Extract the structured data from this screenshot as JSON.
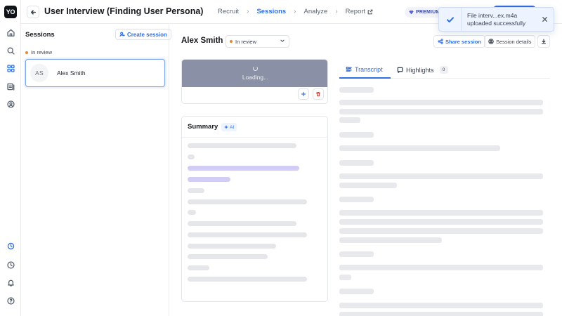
{
  "app": {
    "logo_text": "YO",
    "project_title": "User Interview (Finding User Persona)"
  },
  "nav_steps": [
    {
      "label": "Recruit",
      "active": false
    },
    {
      "label": "Sessions",
      "active": true
    },
    {
      "label": "Analyze",
      "active": false
    },
    {
      "label": "Report",
      "active": false
    }
  ],
  "premium_label": "PREMIUM",
  "toast": {
    "line1": "File interv...ex.m4a",
    "line2": "uploaded successfully"
  },
  "sessions_panel": {
    "title": "Sessions",
    "create_label": "Create session",
    "group_label": "In review",
    "items": [
      {
        "initials": "AS",
        "name": "Alex Smith"
      }
    ]
  },
  "session_header": {
    "name": "Alex Smith",
    "status": "In review",
    "share_label": "Share session",
    "details_label": "Session details"
  },
  "media": {
    "loading_text": "Loading..."
  },
  "summary": {
    "title": "Summary",
    "ai_label": "AI"
  },
  "tabs": {
    "transcript_label": "Transcript",
    "highlights_label": "Highlights",
    "highlights_count": "0"
  },
  "colors": {
    "accent": "#2f6fe4",
    "status_dot": "#e08a2f",
    "delete": "#d9453a",
    "media_bg": "#8a91a6"
  }
}
